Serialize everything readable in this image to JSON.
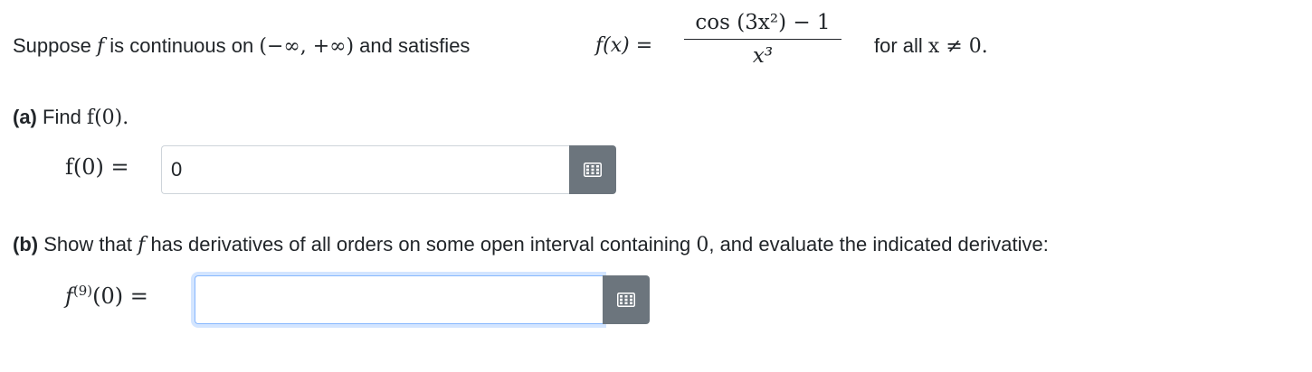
{
  "problem": {
    "intro_1": "Suppose ",
    "f_symbol": "f",
    "intro_2": " is continuous on ",
    "interval": "(−∞, +∞)",
    "intro_3": " and satisfies",
    "f_of_x": "f(x) =",
    "numerator": "cos (3x²) − 1",
    "denominator": "x³",
    "for_all_text": "for all ",
    "condition": "x ≠ 0."
  },
  "part_a": {
    "tag": "(a)",
    "prompt_text": " Find ",
    "prompt_math": "f(0).",
    "answer_label": "f(0) =",
    "input_value": "0",
    "icon": "keypad-grid-icon"
  },
  "part_b": {
    "tag": "(b)",
    "prompt_1": " Show that ",
    "f_symbol": "f",
    "prompt_2": " has derivatives of all orders on some open interval containing ",
    "zero": "0",
    "prompt_3": ", and evaluate the indicated derivative:",
    "answer_label_f": "f",
    "answer_label_order": "(9)",
    "answer_label_rest": "(0) =",
    "input_value": "",
    "icon": "keypad-grid-icon"
  },
  "colors": {
    "button_bg": "#6c757d",
    "text": "#212529",
    "focus_border": "#86b7fe"
  }
}
